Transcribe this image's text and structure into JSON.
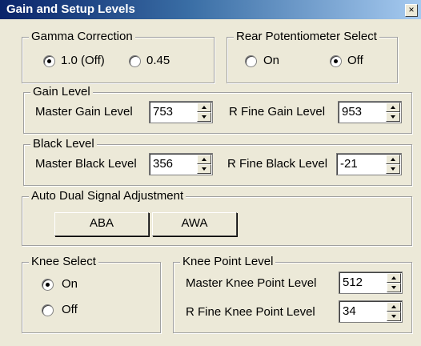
{
  "window": {
    "title": "Gain and Setup Levels",
    "close_glyph": "×"
  },
  "gamma": {
    "legend": "Gamma Correction",
    "options": [
      "1.0 (Off)",
      "0.45"
    ],
    "selected": "1.0 (Off)"
  },
  "rear_pot": {
    "legend": "Rear Potentiometer Select",
    "options": [
      "On",
      "Off"
    ],
    "selected": "Off"
  },
  "gain": {
    "legend": "Gain Level",
    "master_label": "Master Gain Level",
    "master_value": "753",
    "rfine_label": "R Fine Gain Level",
    "rfine_value": "953"
  },
  "black": {
    "legend": "Black Level",
    "master_label": "Master Black Level",
    "master_value": "356",
    "rfine_label": "R Fine Black Level",
    "rfine_value": "-21"
  },
  "auto_dual": {
    "legend": "Auto Dual Signal Adjustment",
    "aba_label": "ABA",
    "awa_label": "AWA"
  },
  "knee_select": {
    "legend": "Knee Select",
    "options": [
      "On",
      "Off"
    ],
    "selected": "On"
  },
  "knee_point": {
    "legend": "Knee Point Level",
    "master_label": "Master Knee Point Level",
    "master_value": "512",
    "rfine_label": "R Fine Knee Point Level",
    "rfine_value": "34"
  },
  "icons": {
    "close": "close-icon",
    "spin_up": "chevron-up-icon",
    "spin_down": "chevron-down-icon"
  },
  "colors": {
    "title_start": "#0a246a",
    "title_end": "#a6caf0",
    "dialog_bg": "#ece9d8"
  }
}
